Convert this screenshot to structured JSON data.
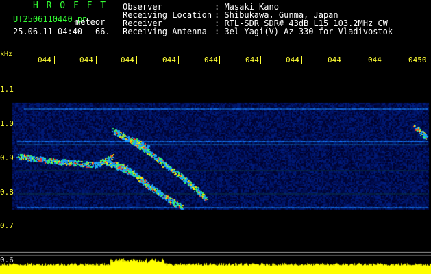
{
  "header": {
    "brand": "H R O F F T",
    "filename": "UT2506110440.pn",
    "mode_label": "meteor",
    "datetime": "25.06.11 04:40",
    "count": "66.",
    "info": [
      {
        "key": "Observer",
        "value": ": Masaki Kano"
      },
      {
        "key": "Receiving Location",
        "value": ": Shibukawa, Gunma, Japan"
      },
      {
        "key": "Receiver",
        "value": ": RTL-SDR SDR# 43dB L15 103.2MHz CW"
      },
      {
        "key": "Receiving Antenna",
        "value": ": 3el Yagi(V) Az 330 for Vladivostok"
      }
    ]
  },
  "time_axis": {
    "labels": [
      "044",
      "044",
      "044",
      "044",
      "044",
      "044",
      "044",
      "044",
      "044",
      "0450"
    ]
  },
  "freq_axis": {
    "unit": "kHz",
    "labels": [
      "1.1",
      "1.0",
      "0.9",
      "0.8",
      "0.7",
      "0.6"
    ]
  },
  "colors": {
    "background": "#000000",
    "header_text": "#ffffff",
    "brand": "#33ff33",
    "axis": "#ffff33",
    "baseline_bar": "#ffff00"
  }
}
